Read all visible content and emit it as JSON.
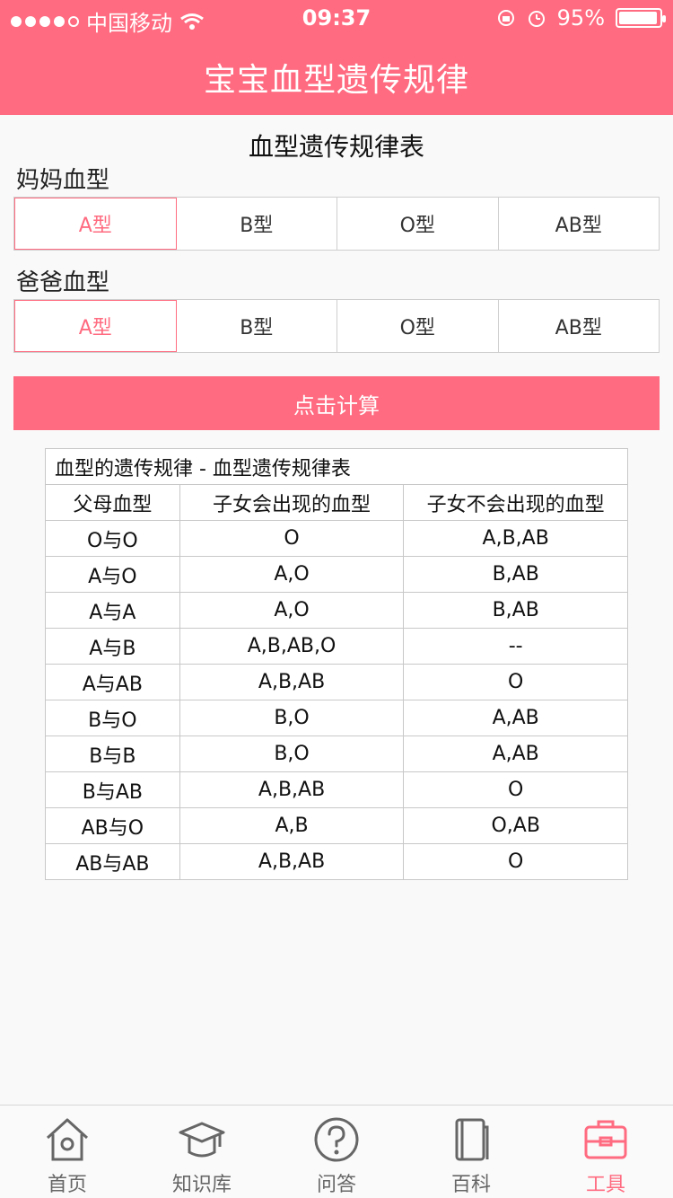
{
  "status": {
    "carrier": "中国移动",
    "time": "09:37",
    "battery_text": "95%",
    "battery_percent": 95
  },
  "header": {
    "title": "宝宝血型遗传规律"
  },
  "content": {
    "heading": "血型遗传规律表",
    "mom_label": "妈妈血型",
    "dad_label": "爸爸血型",
    "mom_options": [
      "A型",
      "B型",
      "O型",
      "AB型"
    ],
    "dad_options": [
      "A型",
      "B型",
      "O型",
      "AB型"
    ],
    "mom_selected_index": 0,
    "dad_selected_index": 0,
    "calc_button": "点击计算",
    "table": {
      "title": "血型的遗传规律 - 血型遗传规律表",
      "headers": [
        "父母血型",
        "子女会出现的血型",
        "子女不会出现的血型"
      ],
      "rows": [
        [
          "O与O",
          "O",
          "A,B,AB"
        ],
        [
          "A与O",
          "A,O",
          "B,AB"
        ],
        [
          "A与A",
          "A,O",
          "B,AB"
        ],
        [
          "A与B",
          "A,B,AB,O",
          "--"
        ],
        [
          "A与AB",
          "A,B,AB",
          "O"
        ],
        [
          "B与O",
          "B,O",
          "A,AB"
        ],
        [
          "B与B",
          "B,O",
          "A,AB"
        ],
        [
          "B与AB",
          "A,B,AB",
          "O"
        ],
        [
          "AB与O",
          "A,B",
          "O,AB"
        ],
        [
          "AB与AB",
          "A,B,AB",
          "O"
        ]
      ]
    }
  },
  "tabbar": {
    "items": [
      {
        "label": "首页",
        "icon": "home-icon"
      },
      {
        "label": "知识库",
        "icon": "graduation-cap-icon"
      },
      {
        "label": "问答",
        "icon": "question-icon"
      },
      {
        "label": "百科",
        "icon": "book-icon"
      },
      {
        "label": "工具",
        "icon": "toolbox-icon"
      }
    ],
    "active_index": 4
  },
  "colors": {
    "accent": "#ff6b80",
    "background": "#f9f9f9",
    "border": "#cfcfcf",
    "text": "#222222",
    "tab_inactive": "#666666"
  }
}
